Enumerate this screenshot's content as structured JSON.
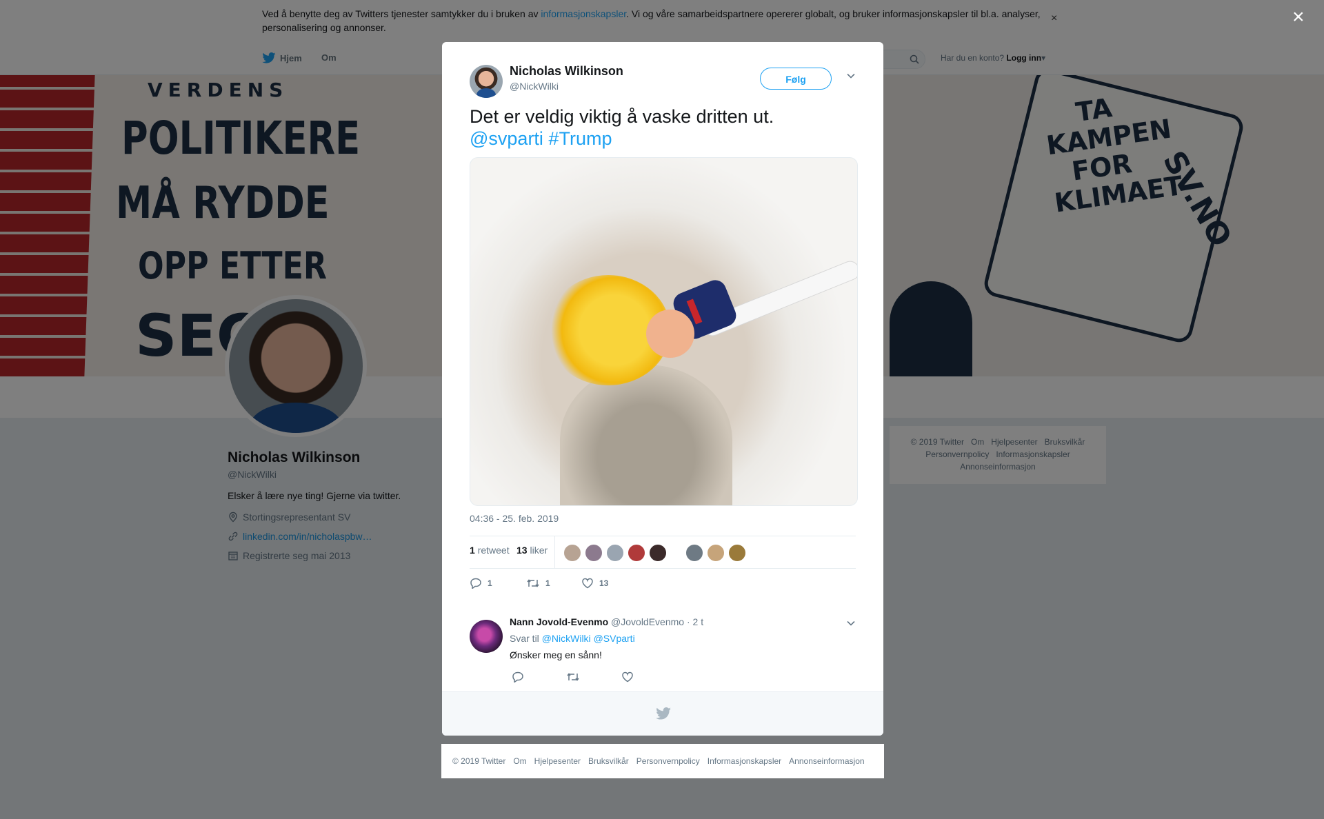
{
  "cookie_banner": {
    "text_before": "Ved å benytte deg av Twitters tjenester samtykker du i bruken av ",
    "link": "informasjonskapsler",
    "text_after": ". Vi og våre samarbeidspartnere opererer globalt, og bruker informasjonskapsler til bl.a. analyser, personalisering og annonser.",
    "close": "×"
  },
  "nav": {
    "home": "Hjem",
    "about": "Om",
    "account_prompt": "Har du en konto?",
    "login": "Logg inn",
    "login_caret": "▾"
  },
  "banner": {
    "left_lines": [
      "VERDENS",
      "POLITIKERE",
      "MÅ RYDDE",
      "OPP ETTER",
      "SEG"
    ],
    "right_lines": [
      "TA",
      "KAMPEN",
      "FOR",
      "KLIMAET"
    ],
    "book_text": "SV.NO"
  },
  "profile": {
    "name": "Nicholas Wilkinson",
    "handle": "@NickWilki",
    "bio": "Elsker å lære nye ting! Gjerne via twitter.",
    "location": "Stortingsrepresentant SV",
    "url": "linkedin.com/in/nicholaspbw…",
    "joined": "Registrerte seg mai 2013"
  },
  "footer_right": {
    "items": [
      "© 2019 Twitter",
      "Om",
      "Hjelpesenter",
      "Bruksvilkår",
      "Personvernpolicy",
      "Informasjonskapsler",
      "Annonseinformasjon"
    ]
  },
  "modal": {
    "close": "×",
    "author_name": "Nicholas Wilkinson",
    "author_handle": "@NickWilki",
    "follow": "Følg",
    "tweet_text": "Det er veldig viktig å vaske dritten ut.",
    "tweet_mention": "@svparti",
    "tweet_hashtag": "#Trump",
    "timestamp": "04:36 - 25. feb. 2019",
    "retweet_count": "1",
    "retweet_label": "retweet",
    "like_count": "13",
    "like_label": "liker",
    "action_reply_count": "1",
    "action_retweet_count": "1",
    "action_like_count": "13",
    "liker_colors": [
      "#b7a393",
      "#8c7a8e",
      "#9aa5b1",
      "#b03a3a",
      "#3b2a2a",
      "#6e7a84",
      "#c6a47a",
      "#9a7a3a"
    ],
    "reply": {
      "name": "Nann Jovold-Evenmo",
      "handle": "@JovoldEvenmo",
      "time": "· 2 t",
      "reply_prefix": "Svar til",
      "reply_to_1": "@NickWilki",
      "reply_to_2": "@SVparti",
      "text": "Ønsker meg en sånn!"
    }
  },
  "footer_bottom": {
    "items": [
      "© 2019 Twitter",
      "Om",
      "Hjelpesenter",
      "Bruksvilkår",
      "Personvernpolicy",
      "Informasjonskapsler",
      "Annonseinformasjon"
    ]
  },
  "colors": {
    "accent": "#1da1f2",
    "link": "#1b95e0",
    "background": "#e6ecf0",
    "scrim": "rgba(0,0,0,0.5)"
  }
}
